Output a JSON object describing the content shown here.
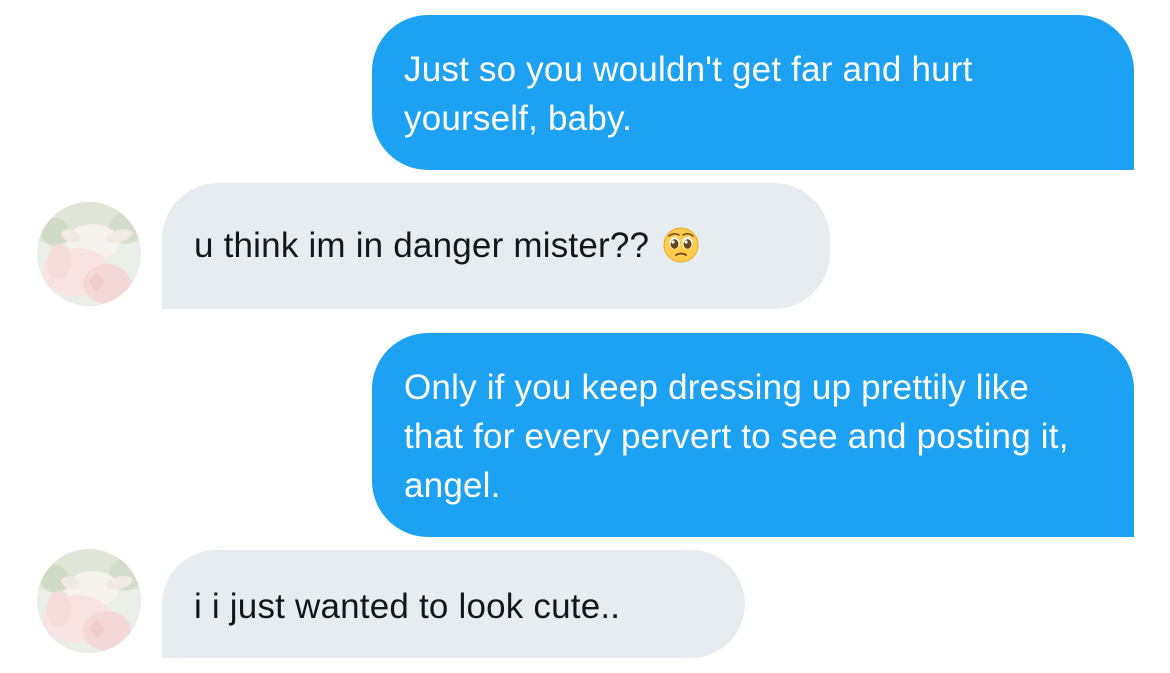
{
  "conversation": {
    "messages": [
      {
        "direction": "outgoing",
        "text": "Just so you wouldn't get far and hurt yourself, baby."
      },
      {
        "direction": "incoming",
        "text": "u think im in danger mister??",
        "emoji": "pleading-face-emoji"
      },
      {
        "direction": "outgoing",
        "text": "Only if you keep dressing up prettily like that for every pervert to see and posting it, angel."
      },
      {
        "direction": "incoming",
        "text": "i i just wanted to look cute.."
      }
    ]
  },
  "colors": {
    "outgoing_bubble": "#1da1f2",
    "incoming_bubble": "#e6ecf0",
    "incoming_text": "#14171a",
    "outgoing_text": "#ffffff"
  },
  "icons": {
    "avatar": "goat-photo-avatar",
    "emoji": "pleading-face-emoji"
  }
}
